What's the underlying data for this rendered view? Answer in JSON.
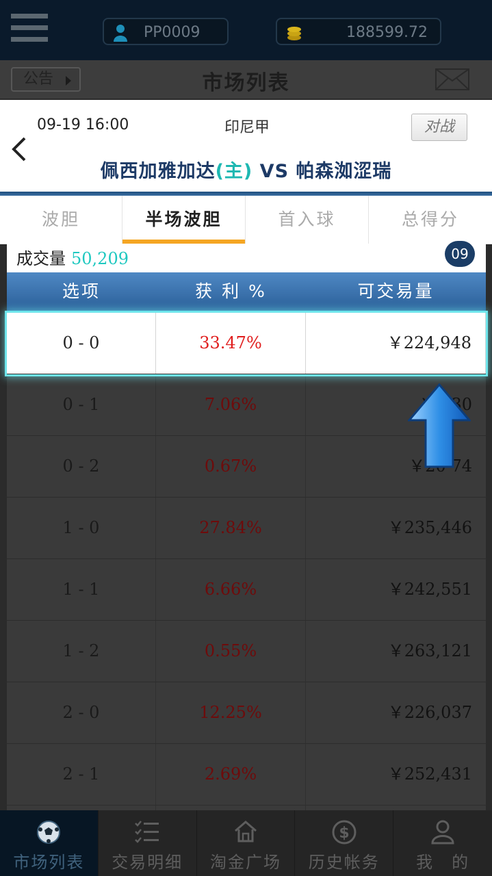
{
  "header": {
    "user_id": "PP0009",
    "balance": "188599.72"
  },
  "titlebar": {
    "notice_label": "公告",
    "title": "市场列表"
  },
  "match": {
    "time": "09-19 16:00",
    "league": "印尼甲",
    "vs_button": "对战",
    "home_team": "佩西加雅加达",
    "home_tag": "(主)",
    "vs": "VS",
    "away_team": "帕森洳涩瑞"
  },
  "tabs": [
    {
      "label": "波胆"
    },
    {
      "label": "半场波胆"
    },
    {
      "label": "首入球"
    },
    {
      "label": "总得分"
    }
  ],
  "active_tab": "半场波胆",
  "volume": {
    "label": "成交量",
    "value": "50,209",
    "badge": "09"
  },
  "table": {
    "headers": [
      "选项",
      "获 利 %",
      "可交易量"
    ],
    "rows": [
      {
        "option": "0 - 0",
        "profit": "33.47%",
        "volume": "￥224,948"
      },
      {
        "option": "0 - 1",
        "profit": "7.06%",
        "volume": "￥2   30"
      },
      {
        "option": "0 - 2",
        "profit": "0.67%",
        "volume": "￥20   74"
      },
      {
        "option": "1 - 0",
        "profit": "27.84%",
        "volume": "￥235,446"
      },
      {
        "option": "1 - 1",
        "profit": "6.66%",
        "volume": "￥242,551"
      },
      {
        "option": "1 - 2",
        "profit": "0.55%",
        "volume": "￥263,121"
      },
      {
        "option": "2 - 0",
        "profit": "12.25%",
        "volume": "￥226,037"
      },
      {
        "option": "2 - 1",
        "profit": "2.69%",
        "volume": "￥252,431"
      }
    ]
  },
  "bottom_nav": [
    {
      "label": "市场列表",
      "icon": "soccer-ball-icon"
    },
    {
      "label": "交易明细",
      "icon": "checklist-icon"
    },
    {
      "label": "淘金广场",
      "icon": "home-icon"
    },
    {
      "label": "历史帐务",
      "icon": "dollar-coin-icon"
    },
    {
      "label": "我　的",
      "icon": "person-icon"
    }
  ],
  "colors": {
    "accent_tab": "#f5a623",
    "header_blue": "#2b5f98",
    "profit_red": "#e01d1d",
    "volume_teal": "#1ec8c0",
    "highlight_glow": "#6fe6ec"
  }
}
